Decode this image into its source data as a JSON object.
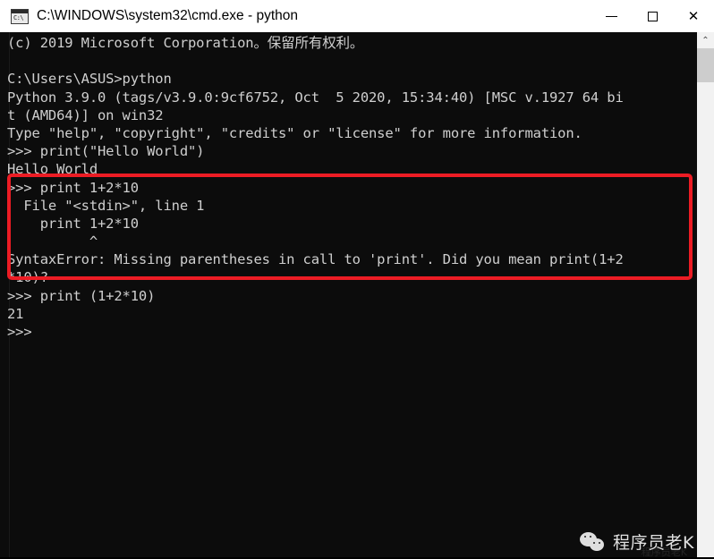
{
  "window": {
    "title": "C:\\WINDOWS\\system32\\cmd.exe - python",
    "icon": "cmd-console-icon",
    "icon_text": "C:\\",
    "controls": {
      "minimize_label": "—",
      "maximize_label": "□",
      "close_label": "✕"
    }
  },
  "terminal": {
    "background_color": "#0c0c0c",
    "text_color": "#cfcfcf",
    "lines": [
      "(c) 2019 Microsoft Corporation。保留所有权利。",
      "",
      "C:\\Users\\ASUS>python",
      "Python 3.9.0 (tags/v3.9.0:9cf6752, Oct  5 2020, 15:34:40) [MSC v.1927 64 bi",
      "t (AMD64)] on win32",
      "Type \"help\", \"copyright\", \"credits\" or \"license\" for more information.",
      ">>> print(\"Hello World\")",
      "Hello World",
      ">>> print 1+2*10",
      "  File \"<stdin>\", line 1",
      "    print 1+2*10",
      "          ^",
      "SyntaxError: Missing parentheses in call to 'print'. Did you mean print(1+2",
      "*10)?",
      ">>> print (1+2*10)",
      "21",
      ">>>"
    ]
  },
  "scrollbar": {
    "up_arrow": "⌃"
  },
  "annotation": {
    "box_color": "#ec1c24",
    "highlights_lines": "SyntaxError block"
  },
  "watermark": {
    "text": "程序员老K",
    "logo": "wechat-logo",
    "faint_text": "程序员老K"
  }
}
